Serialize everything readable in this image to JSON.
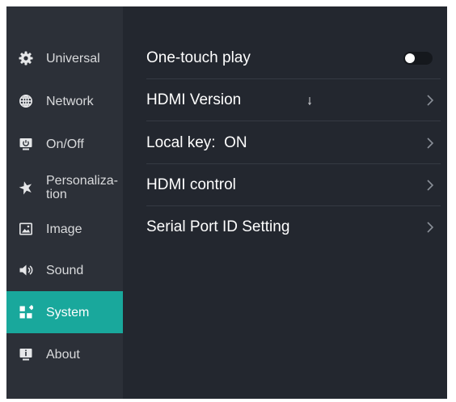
{
  "sidebar": {
    "items": [
      {
        "label": "Universal",
        "icon": "gear-icon",
        "active": false
      },
      {
        "label": "Network",
        "icon": "globe-icon",
        "active": false
      },
      {
        "label": "On/Off",
        "icon": "power-monitor-icon",
        "active": false
      },
      {
        "label": "Personaliza-\ntion",
        "icon": "star-icon",
        "active": false
      },
      {
        "label": "Image",
        "icon": "picture-icon",
        "active": false
      },
      {
        "label": "Sound",
        "icon": "speaker-icon",
        "active": false
      },
      {
        "label": "System",
        "icon": "grid-icon",
        "active": true
      },
      {
        "label": "About",
        "icon": "info-icon",
        "active": false
      }
    ]
  },
  "settings": {
    "rows": [
      {
        "label": "One-touch play",
        "control": "toggle",
        "toggle_state": "off"
      },
      {
        "label": "HDMI Version",
        "control": "chevron"
      },
      {
        "label": "Local key:  ON",
        "control": "chevron"
      },
      {
        "label": "HDMI control",
        "control": "chevron"
      },
      {
        "label": "Serial Port ID Setting",
        "control": "chevron"
      }
    ]
  },
  "colors": {
    "screen_bg": "#23272f",
    "sidebar_bg": "#2c3038",
    "active_bg": "#19a89c",
    "text": "#ffffff",
    "divider": "#353a43"
  }
}
